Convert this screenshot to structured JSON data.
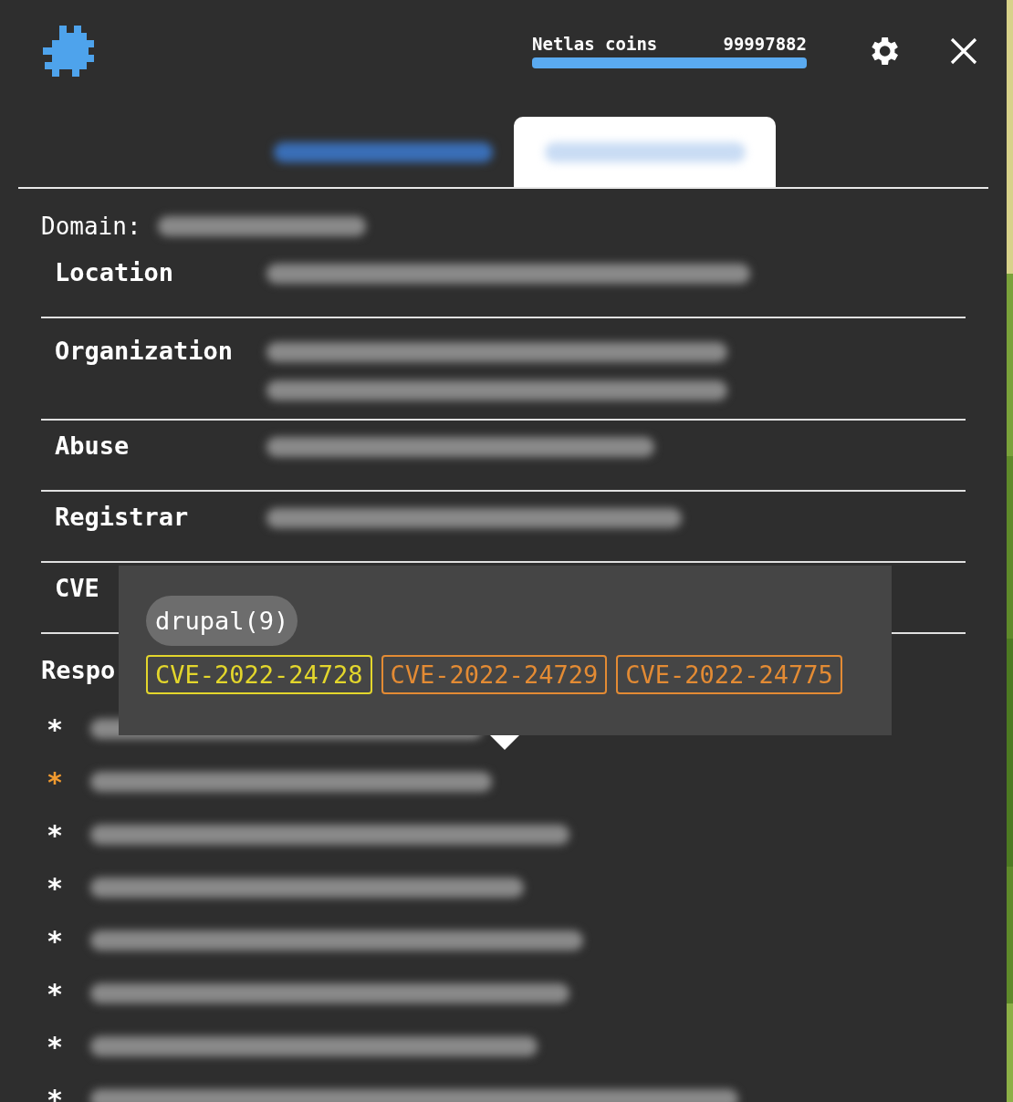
{
  "header": {
    "coins_label": "Netlas coins",
    "coins_value": "99997882",
    "coins": {
      "level": 1
    }
  },
  "tabs": [
    {
      "selected": false
    },
    {
      "selected": true
    }
  ],
  "domain_label": "Domain:",
  "rows": [
    {
      "label": "Location"
    },
    {
      "label": "Organization"
    },
    {
      "label": "Abuse"
    },
    {
      "label": "Registrar"
    },
    {
      "label": "CVE"
    }
  ],
  "responses_label": "Respo",
  "responses": [
    {
      "marker": "*",
      "highlighted": false
    },
    {
      "marker": "*",
      "highlighted": true
    },
    {
      "marker": "*",
      "highlighted": false
    },
    {
      "marker": "*",
      "highlighted": false
    },
    {
      "marker": "*",
      "highlighted": false
    },
    {
      "marker": "*",
      "highlighted": false
    },
    {
      "marker": "*",
      "highlighted": false
    },
    {
      "marker": "*",
      "highlighted": false
    }
  ],
  "tooltip": {
    "software": "drupal(9)",
    "cves": [
      {
        "id": "CVE-2022-24728",
        "color": "#e3d62c"
      },
      {
        "id": "CVE-2022-24729",
        "color": "#e38b34"
      },
      {
        "id": "CVE-2022-24775",
        "color": "#e38b34"
      }
    ]
  }
}
